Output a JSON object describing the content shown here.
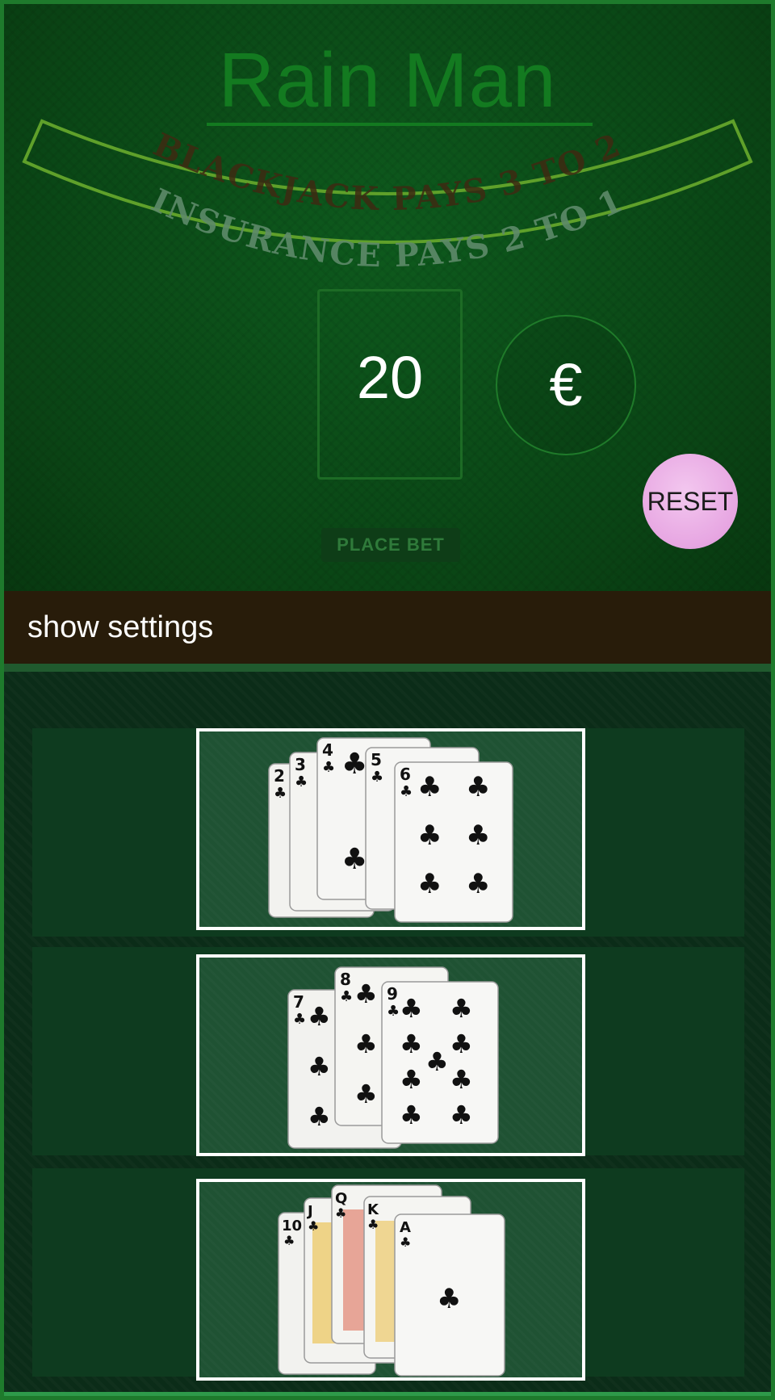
{
  "game": {
    "title": "Rain Man",
    "arc_text_top": "BLACKJACK PAYS 3 TO 2",
    "arc_text_bottom": "INSURANCE PAYS 2 TO 1",
    "bet_amount": "20",
    "currency_symbol": "€",
    "reset_label": "RESET",
    "place_bet_label": "PLACE BET"
  },
  "settings": {
    "toggle_label": "show settings"
  },
  "strategy_cards": [
    {
      "name": "cards-2-to-6",
      "ranks": [
        "2",
        "3",
        "4",
        "5",
        "6"
      ],
      "suit": "clubs"
    },
    {
      "name": "cards-7-to-9",
      "ranks": [
        "7",
        "8",
        "9"
      ],
      "suit": "clubs"
    },
    {
      "name": "cards-10-to-ace",
      "ranks": [
        "10",
        "J",
        "Q",
        "K",
        "A"
      ],
      "suit": "clubs"
    }
  ],
  "colors": {
    "felt": "#0a4515",
    "title": "#137a20",
    "reset_button": "#e7a6e2",
    "settings_bar": "#281c0a",
    "card_tile_border": "#ffffff"
  }
}
